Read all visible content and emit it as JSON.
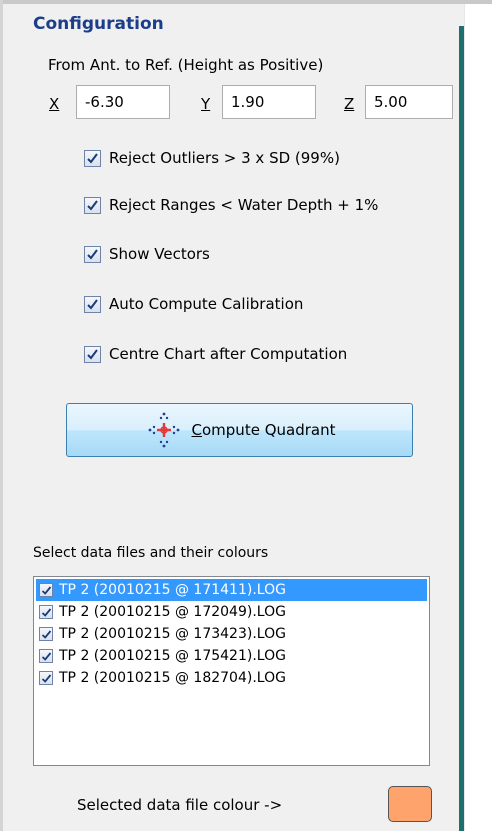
{
  "config": {
    "title": "Configuration",
    "subtitle": "From Ant. to Ref. (Height as Positive)",
    "x_label": "X",
    "y_label": "Y",
    "z_label": "Z",
    "x_value": "-6.30",
    "y_value": "1.90",
    "z_value": "5.00"
  },
  "options": [
    {
      "label": "Reject Outliers > 3 x SD (99%)",
      "checked": true
    },
    {
      "label": "Reject Ranges < Water Depth + 1%",
      "checked": true
    },
    {
      "label": "Show Vectors",
      "checked": true
    },
    {
      "label": "Auto Compute Calibration",
      "checked": true
    },
    {
      "label": "Centre Chart after Computation",
      "checked": true
    }
  ],
  "compute_button": {
    "mnemonic": "C",
    "rest": "ompute Quadrant"
  },
  "files": {
    "label": "Select data files and their  colours",
    "items": [
      {
        "name": "TP 2 (20010215 @ 171411).LOG",
        "checked": true,
        "selected": true
      },
      {
        "name": "TP 2 (20010215 @ 172049).LOG",
        "checked": true,
        "selected": false
      },
      {
        "name": "TP 2 (20010215 @ 173423).LOG",
        "checked": true,
        "selected": false
      },
      {
        "name": "TP 2 (20010215 @ 175421).LOG",
        "checked": true,
        "selected": false
      },
      {
        "name": "TP 2 (20010215 @ 182704).LOG",
        "checked": true,
        "selected": false
      }
    ]
  },
  "colour": {
    "label": "Selected data file colour ->",
    "swatch": "#ffa36c"
  },
  "colors": {
    "title": "#1b3d8a",
    "accent_bar": "#1f6f6f",
    "selection": "#3399ff"
  }
}
